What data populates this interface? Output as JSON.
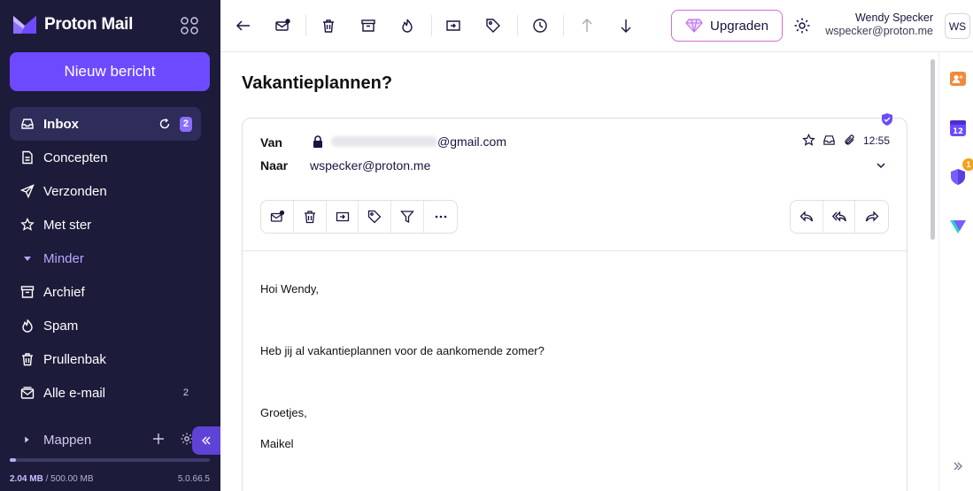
{
  "brand": {
    "name": "Proton Mail"
  },
  "compose": {
    "label": "Nieuw bericht"
  },
  "nav": {
    "inbox": {
      "label": "Inbox",
      "badge": "2"
    },
    "drafts": {
      "label": "Concepten"
    },
    "sent": {
      "label": "Verzonden"
    },
    "starred": {
      "label": "Met ster"
    },
    "less": {
      "label": "Minder"
    },
    "archive": {
      "label": "Archief"
    },
    "spam": {
      "label": "Spam"
    },
    "trash": {
      "label": "Prullenbak"
    },
    "all": {
      "label": "Alle e-mail",
      "count": "2"
    }
  },
  "folders": {
    "label": "Mappen"
  },
  "storage": {
    "used": "2.04 MB",
    "total": " / 500.00 MB",
    "fraction": 0.004
  },
  "version": "5.0.66.5",
  "toolbar": {
    "upgrade_label": "Upgraden"
  },
  "user": {
    "name": "Wendy Specker",
    "email": "wspecker@proton.me",
    "initials": "WS"
  },
  "message": {
    "subject": "Vakantieplannen?",
    "from_label": "Van",
    "from_domain": "@gmail.com",
    "to_label": "Naar",
    "to_value": "wspecker@proton.me",
    "time": "12:55",
    "body": {
      "greeting": "Hoi Wendy,",
      "line1": "Heb jij al vakantieplannen voor de aankomende zomer?",
      "closing": "Groetjes,",
      "signature": "Maikel"
    }
  },
  "rail": {
    "security_badge": "1",
    "calendar_day": "12"
  },
  "colors": {
    "sidebar": "#1c1b3a",
    "accent": "#6d4aff",
    "active_item": "#2e2c58"
  }
}
